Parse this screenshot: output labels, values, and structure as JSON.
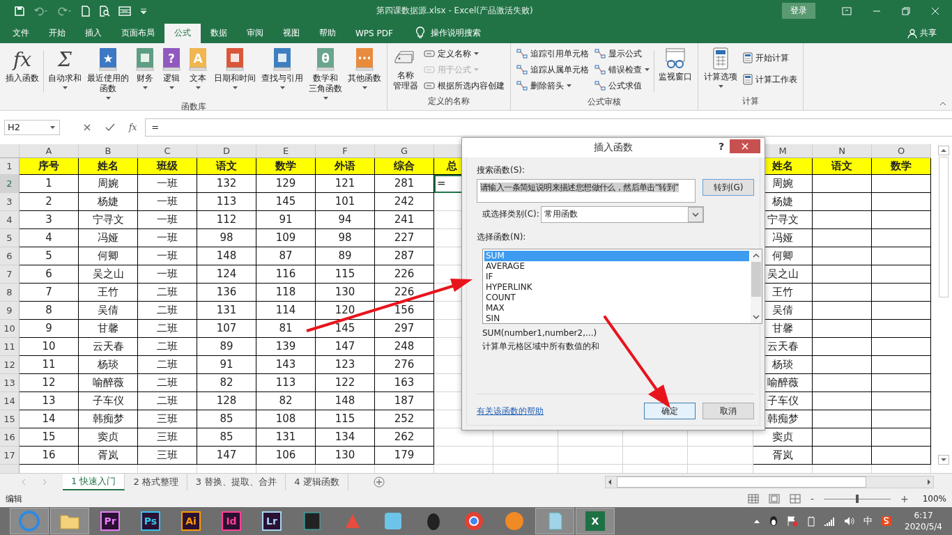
{
  "title_bar": {
    "title": "第四课数据源.xlsx  -  Excel(产品激活失败)",
    "login": "登录"
  },
  "ribbon_tabs": [
    {
      "label": "文件",
      "selected": false
    },
    {
      "label": "开始",
      "selected": false
    },
    {
      "label": "插入",
      "selected": false
    },
    {
      "label": "页面布局",
      "selected": false
    },
    {
      "label": "公式",
      "selected": true
    },
    {
      "label": "数据",
      "selected": false
    },
    {
      "label": "审阅",
      "selected": false
    },
    {
      "label": "视图",
      "selected": false
    },
    {
      "label": "帮助",
      "selected": false
    },
    {
      "label": "WPS PDF",
      "selected": false
    }
  ],
  "tell_me": "操作说明搜索",
  "share": "共享",
  "function_library": {
    "title": "函数库",
    "buttons": [
      {
        "kind": "plain",
        "glyph": "fx",
        "lines": [
          "插入函数"
        ],
        "dropdown": false,
        "color": "#444444"
      },
      {
        "kind": "plain",
        "glyph": "Σ",
        "lines": [
          "自动求和"
        ],
        "dropdown": true,
        "color": "#444444"
      },
      {
        "kind": "book",
        "glyph": "★",
        "lines": [
          "最近使用的",
          "函数"
        ],
        "dropdown": true,
        "color": "#3c78c3"
      },
      {
        "kind": "book",
        "lines": [
          "财务"
        ],
        "dropdown": true,
        "color": "#5e9e82"
      },
      {
        "kind": "book",
        "glyph": "?",
        "lines": [
          "逻辑"
        ],
        "dropdown": true,
        "color": "#9159c0"
      },
      {
        "kind": "book",
        "glyph": "A",
        "lines": [
          "文本"
        ],
        "dropdown": true,
        "color": "#f0b650"
      },
      {
        "kind": "book",
        "lines": [
          "日期和时间"
        ],
        "dropdown": true,
        "color": "#d9573a"
      },
      {
        "kind": "book",
        "lines": [
          "查找与引用"
        ],
        "dropdown": true,
        "color": "#3f7fc0"
      },
      {
        "kind": "book",
        "glyph": "θ",
        "lines": [
          "数学和",
          "三角函数"
        ],
        "dropdown": true,
        "color": "#6aa58d"
      },
      {
        "kind": "book",
        "glyph": "···",
        "lines": [
          "其他函数"
        ],
        "dropdown": true,
        "color": "#e88b3c"
      }
    ]
  },
  "defined_names": {
    "title": "定义的名称",
    "large": {
      "lines": [
        "名称",
        "管理器"
      ]
    },
    "items": [
      {
        "label": "定义名称",
        "dropdown": true,
        "disabled": false
      },
      {
        "label": "用于公式",
        "dropdown": true,
        "disabled": true
      },
      {
        "label": "根据所选内容创建",
        "dropdown": false,
        "disabled": false
      }
    ]
  },
  "formula_auditing": {
    "title": "公式审核",
    "columns": [
      [
        {
          "label": "追踪引用单元格",
          "dropdown": false
        },
        {
          "label": "追踪从属单元格",
          "dropdown": false
        },
        {
          "label": "删除箭头",
          "dropdown": true
        }
      ],
      [
        {
          "label": "显示公式",
          "dropdown": false
        },
        {
          "label": "错误检查",
          "dropdown": true
        },
        {
          "label": "公式求值",
          "dropdown": false
        }
      ]
    ],
    "large": {
      "lines": [
        "监视窗口"
      ]
    }
  },
  "calculation": {
    "title": "计算",
    "large": {
      "lines": [
        "计算选项"
      ]
    },
    "items": [
      {
        "label": "开始计算"
      },
      {
        "label": "计算工作表"
      }
    ]
  },
  "formula_bar": {
    "name_box": "H2",
    "fx": "fx",
    "content": "="
  },
  "sheet": {
    "columns_left": [
      "A",
      "B",
      "C",
      "D",
      "E",
      "F",
      "G"
    ],
    "columns_right": [
      "M",
      "N",
      "O"
    ],
    "header_row": {
      "number": "1",
      "cells": [
        "序号",
        "姓名",
        "班级",
        "语文",
        "数学",
        "外语",
        "综合"
      ],
      "h": "总",
      "right": [
        "姓名",
        "语文",
        "数学"
      ]
    },
    "rows": [
      {
        "number": "2",
        "cells": [
          "1",
          "周婉",
          "一班",
          "132",
          "129",
          "121",
          "281"
        ],
        "h": "=",
        "h_selected": true,
        "m": "周婉"
      },
      {
        "number": "3",
        "cells": [
          "2",
          "杨婕",
          "一班",
          "113",
          "145",
          "101",
          "242"
        ],
        "h_selected": false,
        "m": "杨婕"
      },
      {
        "number": "4",
        "cells": [
          "3",
          "宁寻文",
          "一班",
          "112",
          "91",
          "94",
          "241"
        ],
        "h_selected": false,
        "m": "宁寻文"
      },
      {
        "number": "5",
        "cells": [
          "4",
          "冯娅",
          "一班",
          "98",
          "109",
          "98",
          "227"
        ],
        "h_selected": false,
        "m": "冯娅"
      },
      {
        "number": "6",
        "cells": [
          "5",
          "何卿",
          "一班",
          "148",
          "87",
          "89",
          "287"
        ],
        "h_selected": false,
        "m": "何卿"
      },
      {
        "number": "7",
        "cells": [
          "6",
          "吴之山",
          "一班",
          "124",
          "116",
          "115",
          "226"
        ],
        "h_selected": false,
        "m": "吴之山"
      },
      {
        "number": "8",
        "cells": [
          "7",
          "王竹",
          "二班",
          "136",
          "118",
          "130",
          "226"
        ],
        "h_selected": false,
        "m": "王竹"
      },
      {
        "number": "9",
        "cells": [
          "8",
          "吴倩",
          "二班",
          "131",
          "114",
          "120",
          "156"
        ],
        "h_selected": false,
        "m": "吴倩"
      },
      {
        "number": "10",
        "cells": [
          "9",
          "甘馨",
          "二班",
          "107",
          "81",
          "145",
          "297"
        ],
        "h_selected": false,
        "m": "甘馨"
      },
      {
        "number": "11",
        "cells": [
          "10",
          "云天春",
          "二班",
          "89",
          "139",
          "147",
          "248"
        ],
        "h_selected": false,
        "m": "云天春"
      },
      {
        "number": "12",
        "cells": [
          "11",
          "杨琰",
          "二班",
          "91",
          "143",
          "123",
          "276"
        ],
        "h_selected": false,
        "m": "杨琰"
      },
      {
        "number": "13",
        "cells": [
          "12",
          "喻醉薇",
          "二班",
          "82",
          "113",
          "122",
          "163"
        ],
        "h_selected": false,
        "m": "喻醉薇"
      },
      {
        "number": "14",
        "cells": [
          "13",
          "子车仪",
          "二班",
          "128",
          "82",
          "148",
          "187"
        ],
        "h_selected": false,
        "m": "子车仪"
      },
      {
        "number": "15",
        "cells": [
          "14",
          "韩痴梦",
          "三班",
          "85",
          "108",
          "115",
          "252"
        ],
        "h_selected": false,
        "m": "韩痴梦"
      },
      {
        "number": "16",
        "cells": [
          "15",
          "窦贞",
          "三班",
          "85",
          "131",
          "134",
          "262"
        ],
        "h_selected": false,
        "m": "窦贞"
      },
      {
        "number": "17",
        "cells": [
          "16",
          "胥岚",
          "三班",
          "147",
          "106",
          "130",
          "179"
        ],
        "h_selected": false,
        "m": "胥岚"
      }
    ]
  },
  "dialog": {
    "title": "插入函数",
    "help": "?",
    "search_label": "搜索函数(S):",
    "search_value": "请输入一条简短说明来描述您想做什么，然后单击“转到”",
    "go": "转到(G)",
    "category_label": "或选择类别(C):",
    "category": "常用函数",
    "list_label": "选择函数(N):",
    "functions": [
      {
        "label": "SUM",
        "selected": true
      },
      {
        "label": "AVERAGE",
        "selected": false
      },
      {
        "label": "IF",
        "selected": false
      },
      {
        "label": "HYPERLINK",
        "selected": false
      },
      {
        "label": "COUNT",
        "selected": false
      },
      {
        "label": "MAX",
        "selected": false
      },
      {
        "label": "SIN",
        "selected": false
      }
    ],
    "signature": "SUM(number1,number2,...)",
    "description": "计算单元格区域中所有数值的和",
    "help_link": "有关该函数的帮助",
    "ok": "确定",
    "cancel": "取消"
  },
  "sheet_tabs": [
    {
      "label": "1 快速入门",
      "selected": true
    },
    {
      "label": "2 格式整理",
      "selected": false
    },
    {
      "label": "3 替换、提取、合并",
      "selected": false
    },
    {
      "label": "4 逻辑函数",
      "selected": false
    }
  ],
  "status_bar": {
    "mode": "编辑",
    "zoom_minus": "-",
    "zoom_plus": "+",
    "zoom": {
      "level": 0.5,
      "reading": "100%"
    }
  },
  "taskbar": {
    "apps": [
      {
        "kind": "icon",
        "running": true
      },
      {
        "kind": "icon",
        "running": true
      },
      {
        "kind": "badge",
        "label": "Pr",
        "color": "#e77cf6",
        "running": false
      },
      {
        "kind": "badge",
        "label": "Ps",
        "color": "#31c5f0",
        "running": false
      },
      {
        "kind": "badge",
        "label": "Ai",
        "color": "#ff9a00",
        "running": false
      },
      {
        "kind": "badge",
        "label": "Id",
        "color": "#ff3f94",
        "running": false
      },
      {
        "kind": "badge",
        "label": "Lr",
        "color": "#a8d5f5",
        "running": false
      },
      {
        "kind": "icon",
        "running": false
      },
      {
        "kind": "icon",
        "running": false
      },
      {
        "kind": "icon",
        "running": false
      },
      {
        "kind": "icon",
        "running": false
      },
      {
        "kind": "icon",
        "running": false
      },
      {
        "kind": "icon",
        "running": false
      },
      {
        "kind": "icon",
        "running": true
      },
      {
        "kind": "badge",
        "label": "X",
        "color": "#1e7145",
        "running": true
      }
    ],
    "ime": "中",
    "time": "6:17",
    "date": "2020/5/4"
  }
}
